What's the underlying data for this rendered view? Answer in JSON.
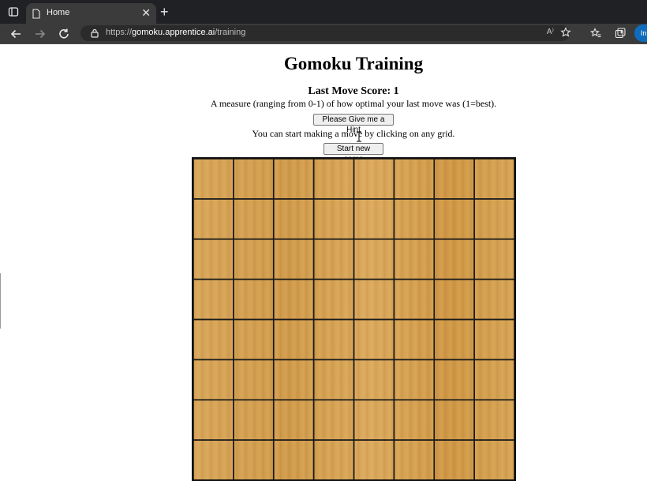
{
  "browser": {
    "tab_title": "Home",
    "tab_close": "✕",
    "new_tab": "+",
    "url_prefix": "https://",
    "url_host": "gomoku.apprentice.ai",
    "url_path": "/training",
    "read_aloud": "A⁾",
    "profile_label": "In"
  },
  "page": {
    "title": "Gomoku Training",
    "score_label": "Last Move Score: 1",
    "score_description": "A measure (ranging from 0-1) of how optimal your last move was (1=best).",
    "hint_button": "Please Give me a Hint",
    "info_text": "You can start making a move by clicking on any grid.",
    "new_game_button": "Start new game"
  },
  "board": {
    "columns": 8,
    "rows_visible": 8,
    "wood_color": "#d6a456",
    "line_color": "#1a1a1a"
  }
}
